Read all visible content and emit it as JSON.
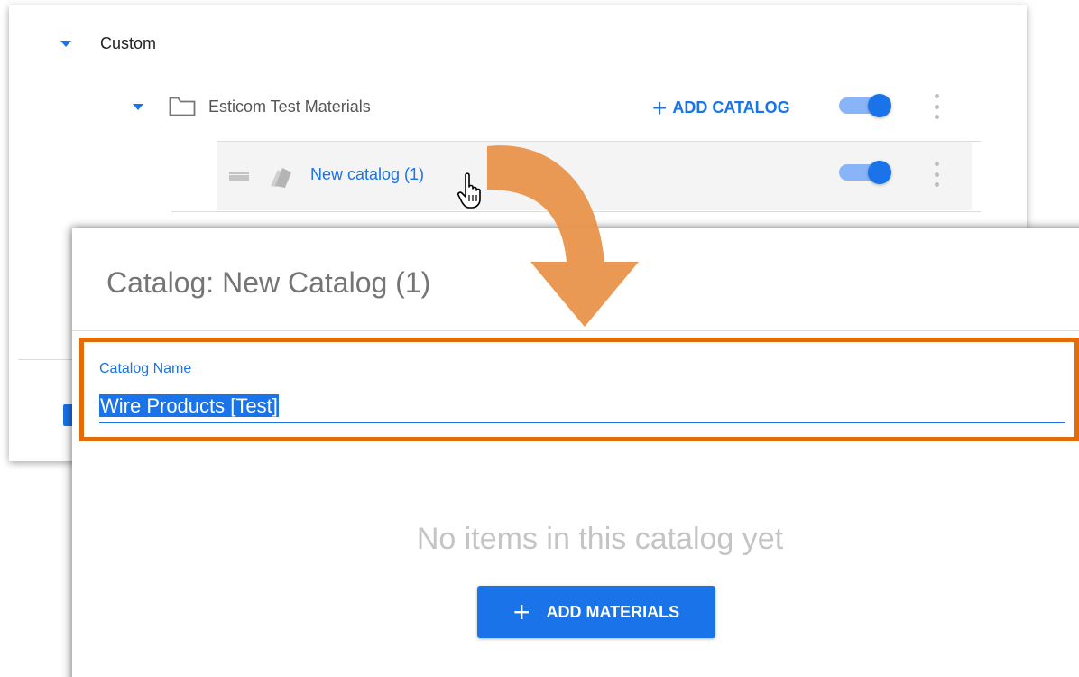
{
  "tree": {
    "group_label": "Custom",
    "folder_label": "Esticom Test Materials",
    "add_catalog_label": "ADD CATALOG",
    "catalog_link": "New catalog (1)",
    "folder_toggle_on": true,
    "catalog_toggle_on": true
  },
  "dialog": {
    "title": "Catalog: New Catalog (1)",
    "field_label": "Catalog Name",
    "field_value": "Wire Products [Test]",
    "empty_text": "No items in this catalog yet",
    "add_materials_label": "ADD MATERIALS"
  },
  "colors": {
    "accent": "#1a73e8",
    "highlight": "#e36c0a",
    "arrow": "#e8944a"
  },
  "icons": {
    "caret": "caret-down-icon",
    "folder": "folder-icon",
    "catalog": "catalog-icon",
    "drag": "drag-handle-icon",
    "kebab": "more-vert-icon",
    "plus": "plus-icon",
    "cursor": "hand-cursor-icon"
  }
}
